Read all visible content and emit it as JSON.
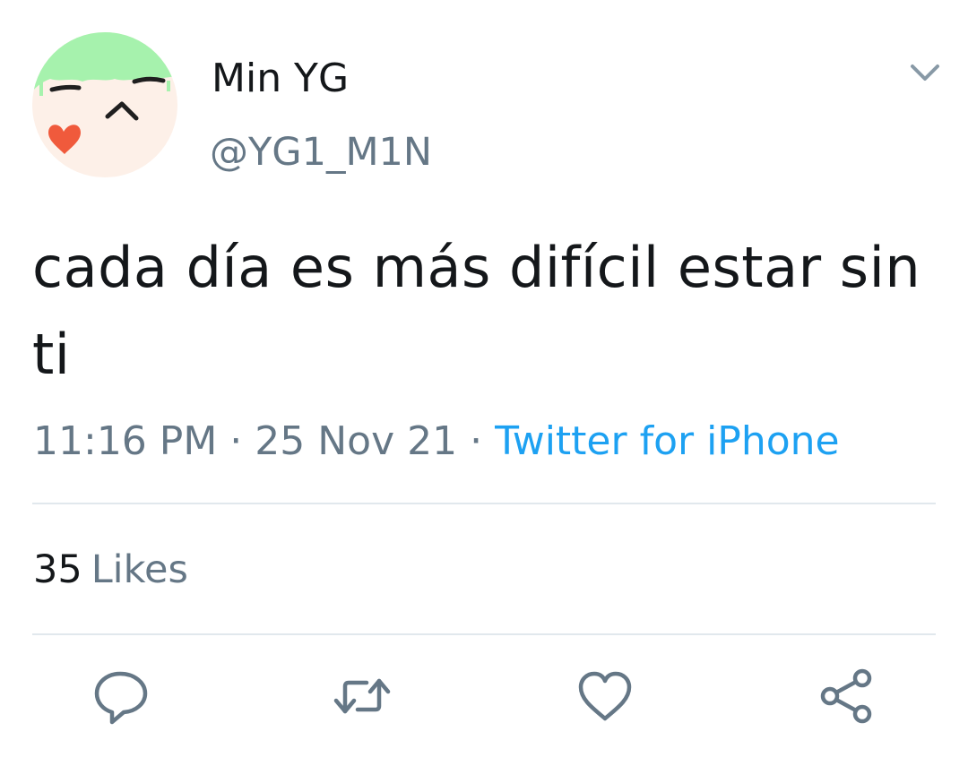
{
  "tweet": {
    "author": {
      "display_name": "Min YG",
      "handle": "@YG1_M1N"
    },
    "text": "cada día es más difícil estar sin ti",
    "meta": {
      "time": "11:16 PM",
      "date": "25 Nov 21",
      "separator": "·",
      "source": "Twitter for iPhone"
    },
    "likes": {
      "count": "35",
      "label": "Likes"
    }
  },
  "icons": {
    "more": "chevron-down-icon",
    "reply": "reply-icon",
    "retweet": "retweet-icon",
    "like": "heart-icon",
    "share": "share-icon"
  },
  "colors": {
    "text": "#14171a",
    "secondary": "#657786",
    "link": "#1da1f2",
    "divider": "#e1e8ed",
    "icon": "#657786",
    "avatar_hair": "#a6f2ad",
    "avatar_face": "#fdf0e8",
    "avatar_heart": "#f05a3c"
  }
}
